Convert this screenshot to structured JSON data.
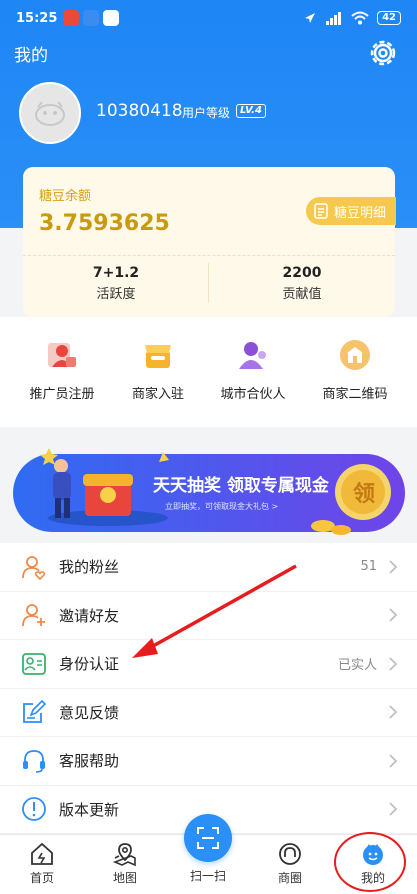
{
  "status_bar": {
    "time": "15:25",
    "battery": "42"
  },
  "header": {
    "title": "我的"
  },
  "profile": {
    "user_id": "10380418",
    "level_label": "用户等级",
    "level_badge": "LV.4"
  },
  "balance": {
    "label": "糖豆余额",
    "value": "3.7593625",
    "detail_button": "糖豆明细",
    "stats": [
      {
        "value": "7+1.2",
        "label": "活跃度"
      },
      {
        "value": "2200",
        "label": "贡献值"
      }
    ]
  },
  "quick_actions": [
    {
      "label": "推广员注册",
      "icon": "promoter-icon"
    },
    {
      "label": "商家入驻",
      "icon": "shop-icon"
    },
    {
      "label": "城市合伙人",
      "icon": "partner-icon"
    },
    {
      "label": "商家二维码",
      "icon": "qrcode-shop-icon"
    }
  ],
  "banner": {
    "title": "天天抽奖 领取专属现金",
    "subtitle": "立即抽奖，可领取现金大礼包 >",
    "badge": "领"
  },
  "menu": [
    {
      "label": "我的粉丝",
      "value": "51",
      "icon": "fans-icon"
    },
    {
      "label": "邀请好友",
      "value": "",
      "icon": "invite-icon"
    },
    {
      "label": "身份认证",
      "value": "已实人",
      "icon": "id-verify-icon"
    },
    {
      "label": "意见反馈",
      "value": "",
      "icon": "feedback-icon"
    },
    {
      "label": "客服帮助",
      "value": "",
      "icon": "headset-icon"
    },
    {
      "label": "版本更新",
      "value": "",
      "icon": "update-icon"
    }
  ],
  "tabs": [
    {
      "label": "首页",
      "icon": "home-icon"
    },
    {
      "label": "地图",
      "icon": "map-icon"
    },
    {
      "label": "扫一扫",
      "icon": "scan-icon"
    },
    {
      "label": "商圈",
      "icon": "circle-icon"
    },
    {
      "label": "我的",
      "icon": "me-icon"
    }
  ],
  "colors": {
    "primary": "#2a8ff7",
    "gold": "#c99a0e",
    "annotation": "#e81c1c"
  }
}
